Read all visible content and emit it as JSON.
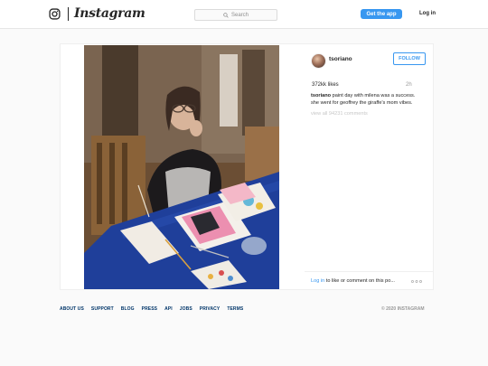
{
  "header": {
    "brand": "Instagram",
    "search_placeholder": "Search",
    "get_app_label": "Get the app",
    "login_label": "Log in"
  },
  "post": {
    "username": "tsoriano",
    "follow_label": "FOLLOW",
    "likes": "372kk likes",
    "time_ago": "2h",
    "caption_user": "tsoriano",
    "caption_text": "paint day with milena was a success. she went for geoffrey the giraffe's mom vibes.",
    "view_all_comments": "view all 94231 comments",
    "login_link": "Log in",
    "login_prompt": " to like or comment on this po..."
  },
  "footer": {
    "links": [
      "ABOUT US",
      "SUPPORT",
      "BLOG",
      "PRESS",
      "API",
      "JOBS",
      "PRIVACY",
      "TERMS"
    ],
    "copyright": "© 2020 INSTAGRAM"
  },
  "colors": {
    "accent": "#3897f0",
    "footer_link": "#003569"
  }
}
